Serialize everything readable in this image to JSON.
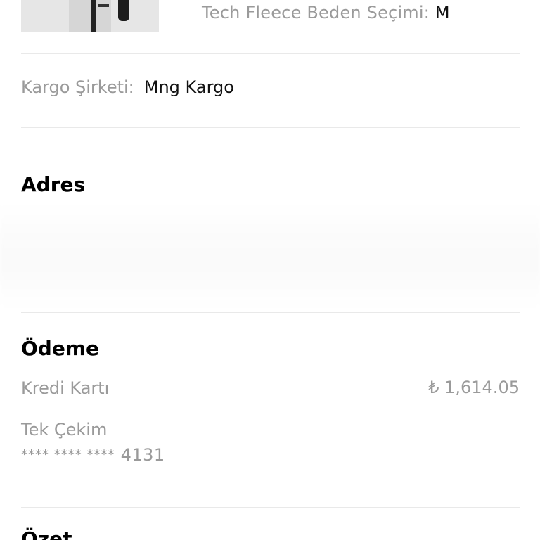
{
  "product": {
    "image_alt": "Tech Fleece jacket",
    "size_label": "Tech Fleece Beden Seçimi:",
    "size_value": "M"
  },
  "shipping": {
    "label": "Kargo Şirketi:",
    "value": "Mng Kargo"
  },
  "address": {
    "title": "Adres"
  },
  "payment": {
    "title": "Ödeme",
    "method": "Kredi Kartı",
    "amount": "₺ 1,614.05",
    "installment": "Tek Çekim",
    "card_mask": "**** **** ****",
    "card_last4": "4131"
  },
  "summary": {
    "title": "Özet"
  }
}
